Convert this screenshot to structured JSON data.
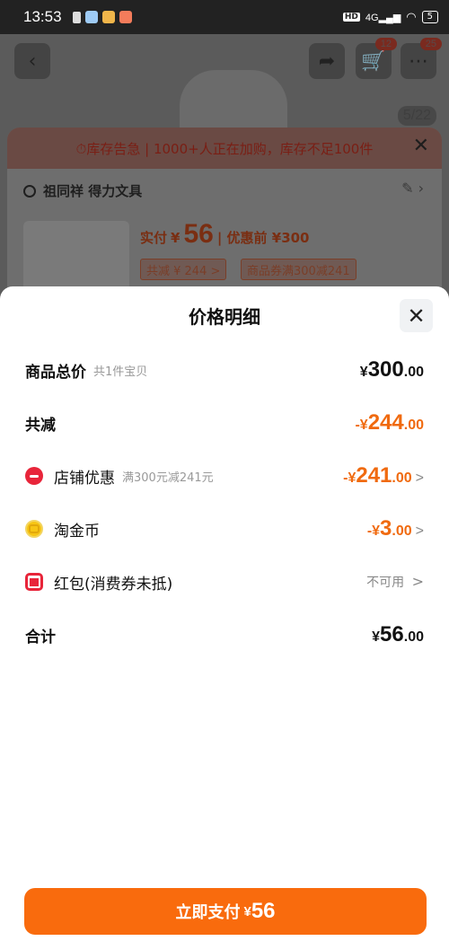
{
  "status_bar": {
    "time": "13:53",
    "network": "4G",
    "hd_label": "HD",
    "battery": "5",
    "icons": [
      "notification-icon",
      "app-icon-1",
      "app-icon-2",
      "app-icon-3",
      "wifi-icon",
      "signal-icon"
    ]
  },
  "background_page": {
    "cart_badge": "12",
    "menu_badge": "25",
    "image_counter": "5/22",
    "stock_alert": "⏱库存告急 | 1000+人正在加购，库存不足100件",
    "store_name": "祖同祥 得力文具",
    "paid_label": "实付",
    "paid_currency": "¥",
    "paid_amount": "56",
    "before_label": "| 优惠前 ¥300",
    "chip_1": "共减 ¥ 244 >",
    "chip_2": "商品券满300减241"
  },
  "sheet": {
    "title": "价格明细",
    "rows": {
      "total": {
        "label": "商品总价",
        "sub": "共1件宝贝",
        "prefix": "¥",
        "int": "300",
        "dec": ".00"
      },
      "reduction": {
        "label": "共减",
        "prefix": "-¥",
        "int": "244",
        "dec": ".00"
      },
      "store_discount": {
        "label": "店铺优惠",
        "sub": "满300元减241元",
        "prefix": "-¥",
        "int": "241",
        "dec": ".00",
        "chevron": ">"
      },
      "coins": {
        "label": "淘金币",
        "prefix": "-¥",
        "int": "3",
        "dec": ".00",
        "chevron": ">"
      },
      "red_packet": {
        "label": "红包(消费券未抵)",
        "status": "不可用",
        "chevron": ">"
      },
      "sum": {
        "label": "合计",
        "prefix": "¥",
        "int": "56",
        "dec": ".00"
      }
    },
    "pay_button": {
      "label": "立即支付",
      "currency": "¥",
      "amount": "56"
    }
  },
  "colors": {
    "accent": "#f96b0d",
    "discount": "#f06a0f",
    "icon_red": "#e8253a",
    "coin": "#f7c514"
  }
}
